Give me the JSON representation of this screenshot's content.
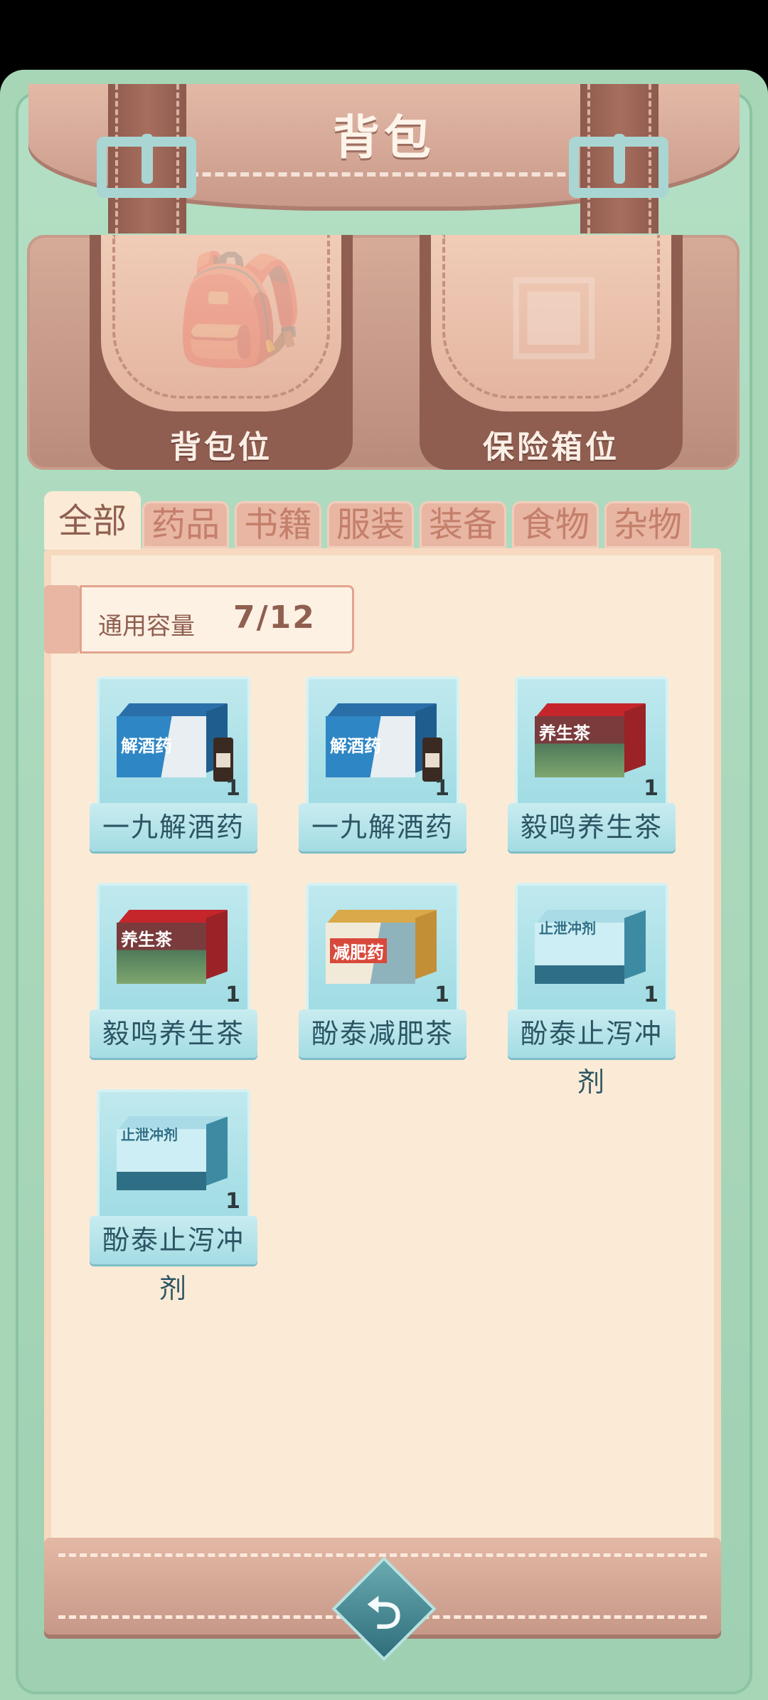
{
  "title": "背包",
  "pockets": [
    {
      "label": "背包位",
      "icon": "backpack-icon"
    },
    {
      "label": "保险箱位",
      "icon": "safe-icon"
    }
  ],
  "tabs": [
    "全部",
    "药品",
    "书籍",
    "服装",
    "装备",
    "食物",
    "杂物"
  ],
  "active_tab": "全部",
  "capacity": {
    "label": "通用容量",
    "value": "7/12"
  },
  "items": [
    {
      "name": "一九解酒药",
      "qty": "1",
      "box_text": "解酒药",
      "icon": "hangover-medicine-box-icon"
    },
    {
      "name": "一九解酒药",
      "qty": "1",
      "box_text": "解酒药",
      "icon": "hangover-medicine-box-icon"
    },
    {
      "name": "毅鸣养生茶",
      "qty": "1",
      "box_text": "养生茶",
      "icon": "health-tea-box-icon"
    },
    {
      "name": "毅鸣养生茶",
      "qty": "1",
      "box_text": "养生茶",
      "icon": "health-tea-box-icon"
    },
    {
      "name": "酚泰减肥茶",
      "qty": "1",
      "box_text": "减肥药",
      "icon": "diet-tea-box-icon"
    },
    {
      "name": "酚泰止泻冲剂",
      "qty": "1",
      "box_text": "止泄冲剂",
      "icon": "antidiarrheal-granules-box-icon"
    },
    {
      "name": "酚泰止泻冲剂",
      "qty": "1",
      "box_text": "止泄冲剂",
      "icon": "antidiarrheal-granules-box-icon"
    }
  ],
  "back_icon": "return-arrow-icon",
  "colors": {
    "background": "#a6d6b6",
    "leather": "#d6ab98",
    "panel": "#fbebd6",
    "slot": "#bfe9ee"
  }
}
